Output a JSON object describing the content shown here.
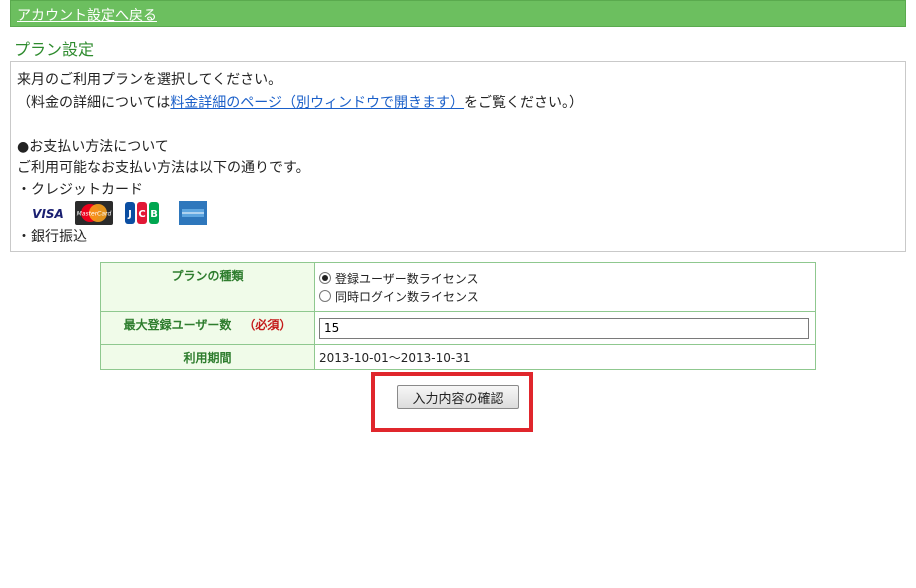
{
  "header": {
    "back_link": "アカウント設定へ戻る"
  },
  "page_title": "プラン設定",
  "info": {
    "line1": "来月のご利用プランを選択してください。",
    "line2_prefix": "（料金の詳細については",
    "line2_link": "料金詳細のページ（別ウィンドウで開きます）",
    "line2_suffix": "をご覧ください。）",
    "payment_heading": "●お支払い方法について",
    "payment_desc": "ご利用可能なお支払い方法は以下の通りです。",
    "method_credit": "・クレジットカード",
    "method_bank": "・銀行振込",
    "cards": [
      {
        "name": "VISA",
        "color": "#1a1f71"
      },
      {
        "name": "MasterCard",
        "color": "#eb001b"
      },
      {
        "name": "JCB",
        "color": "#0b4ea2"
      },
      {
        "name": "AMERICAN EXPRESS",
        "color": "#2e77bc"
      }
    ]
  },
  "form": {
    "plan_type_label": "プランの種類",
    "plan_options": [
      "登録ユーザー数ライセンス",
      "同時ログイン数ライセンス"
    ],
    "plan_selected": "登録ユーザー数ライセンス",
    "max_users_label": "最大登録ユーザー数",
    "required_label": "（必須）",
    "max_users_value": "15",
    "period_label": "利用期間",
    "period_value": "2013-10-01～2013-10-31"
  },
  "confirm_button": "入力内容の確認",
  "highlight_color": "#e0262c"
}
